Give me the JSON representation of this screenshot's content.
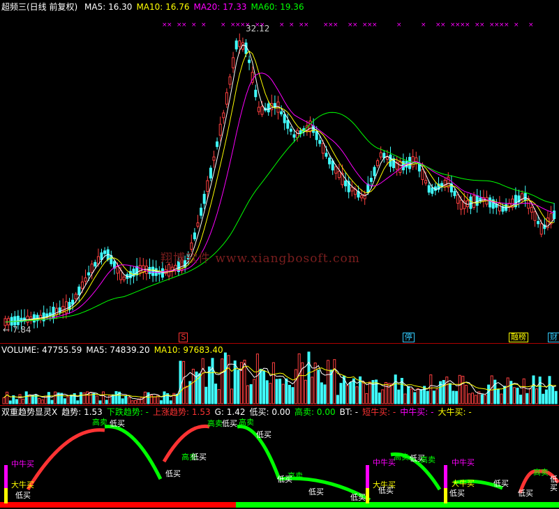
{
  "main": {
    "title": "超频三(日线 前复权)",
    "indicators": [
      {
        "label": "MA5: 16.30",
        "color": "#ffffff"
      },
      {
        "label": "MA10: 16.76",
        "color": "#ffff00"
      },
      {
        "label": "MA20: 17.33",
        "color": "#ff00ff"
      },
      {
        "label": "MA60: 19.36",
        "color": "#00ff00"
      }
    ],
    "high_label": "32.12",
    "low_label": "← 7.84",
    "watermark": "翔博软件 www.xiangbosoft.com",
    "event_markers": [
      {
        "text": "S",
        "color": "#ff3333",
        "pos": 0.32
      },
      {
        "text": "停",
        "color": "#33ccff",
        "pos": 0.72
      },
      {
        "text": "融榜",
        "color": "#ffff00",
        "pos": 0.91
      },
      {
        "text": "财",
        "color": "#33ccff",
        "pos": 0.98
      }
    ]
  },
  "volume": {
    "indicators": [
      {
        "label": "VOLUME: 47755.59",
        "color": "#ffffff"
      },
      {
        "label": "MA5: 74839.20",
        "color": "#ffffff"
      },
      {
        "label": "MA10: 97683.40",
        "color": "#ffff00"
      }
    ]
  },
  "trend": {
    "indicators": [
      {
        "label": "双重趋势显灵X",
        "color": "#ffffff"
      },
      {
        "label": "趋势: 1.53",
        "color": "#ffffff"
      },
      {
        "label": "下跌趋势: -",
        "color": "#00ff00"
      },
      {
        "label": "上涨趋势: 1.53",
        "color": "#ff3333"
      },
      {
        "label": "G: 1.42",
        "color": "#ffffff"
      },
      {
        "label": "低买: 0.00",
        "color": "#ffffff"
      },
      {
        "label": "高卖: 0.00",
        "color": "#00ff00"
      },
      {
        "label": "BT: -",
        "color": "#ffffff"
      },
      {
        "label": "短牛买: -",
        "color": "#ff3333"
      },
      {
        "label": "中牛买: -",
        "color": "#ff00ff"
      },
      {
        "label": "大牛买: -",
        "color": "#ffff00"
      }
    ],
    "signals": {
      "low_buy": "低买",
      "high_sell": "高卖",
      "mid_bull": "中牛买",
      "big_bull": "大牛买"
    }
  }
}
